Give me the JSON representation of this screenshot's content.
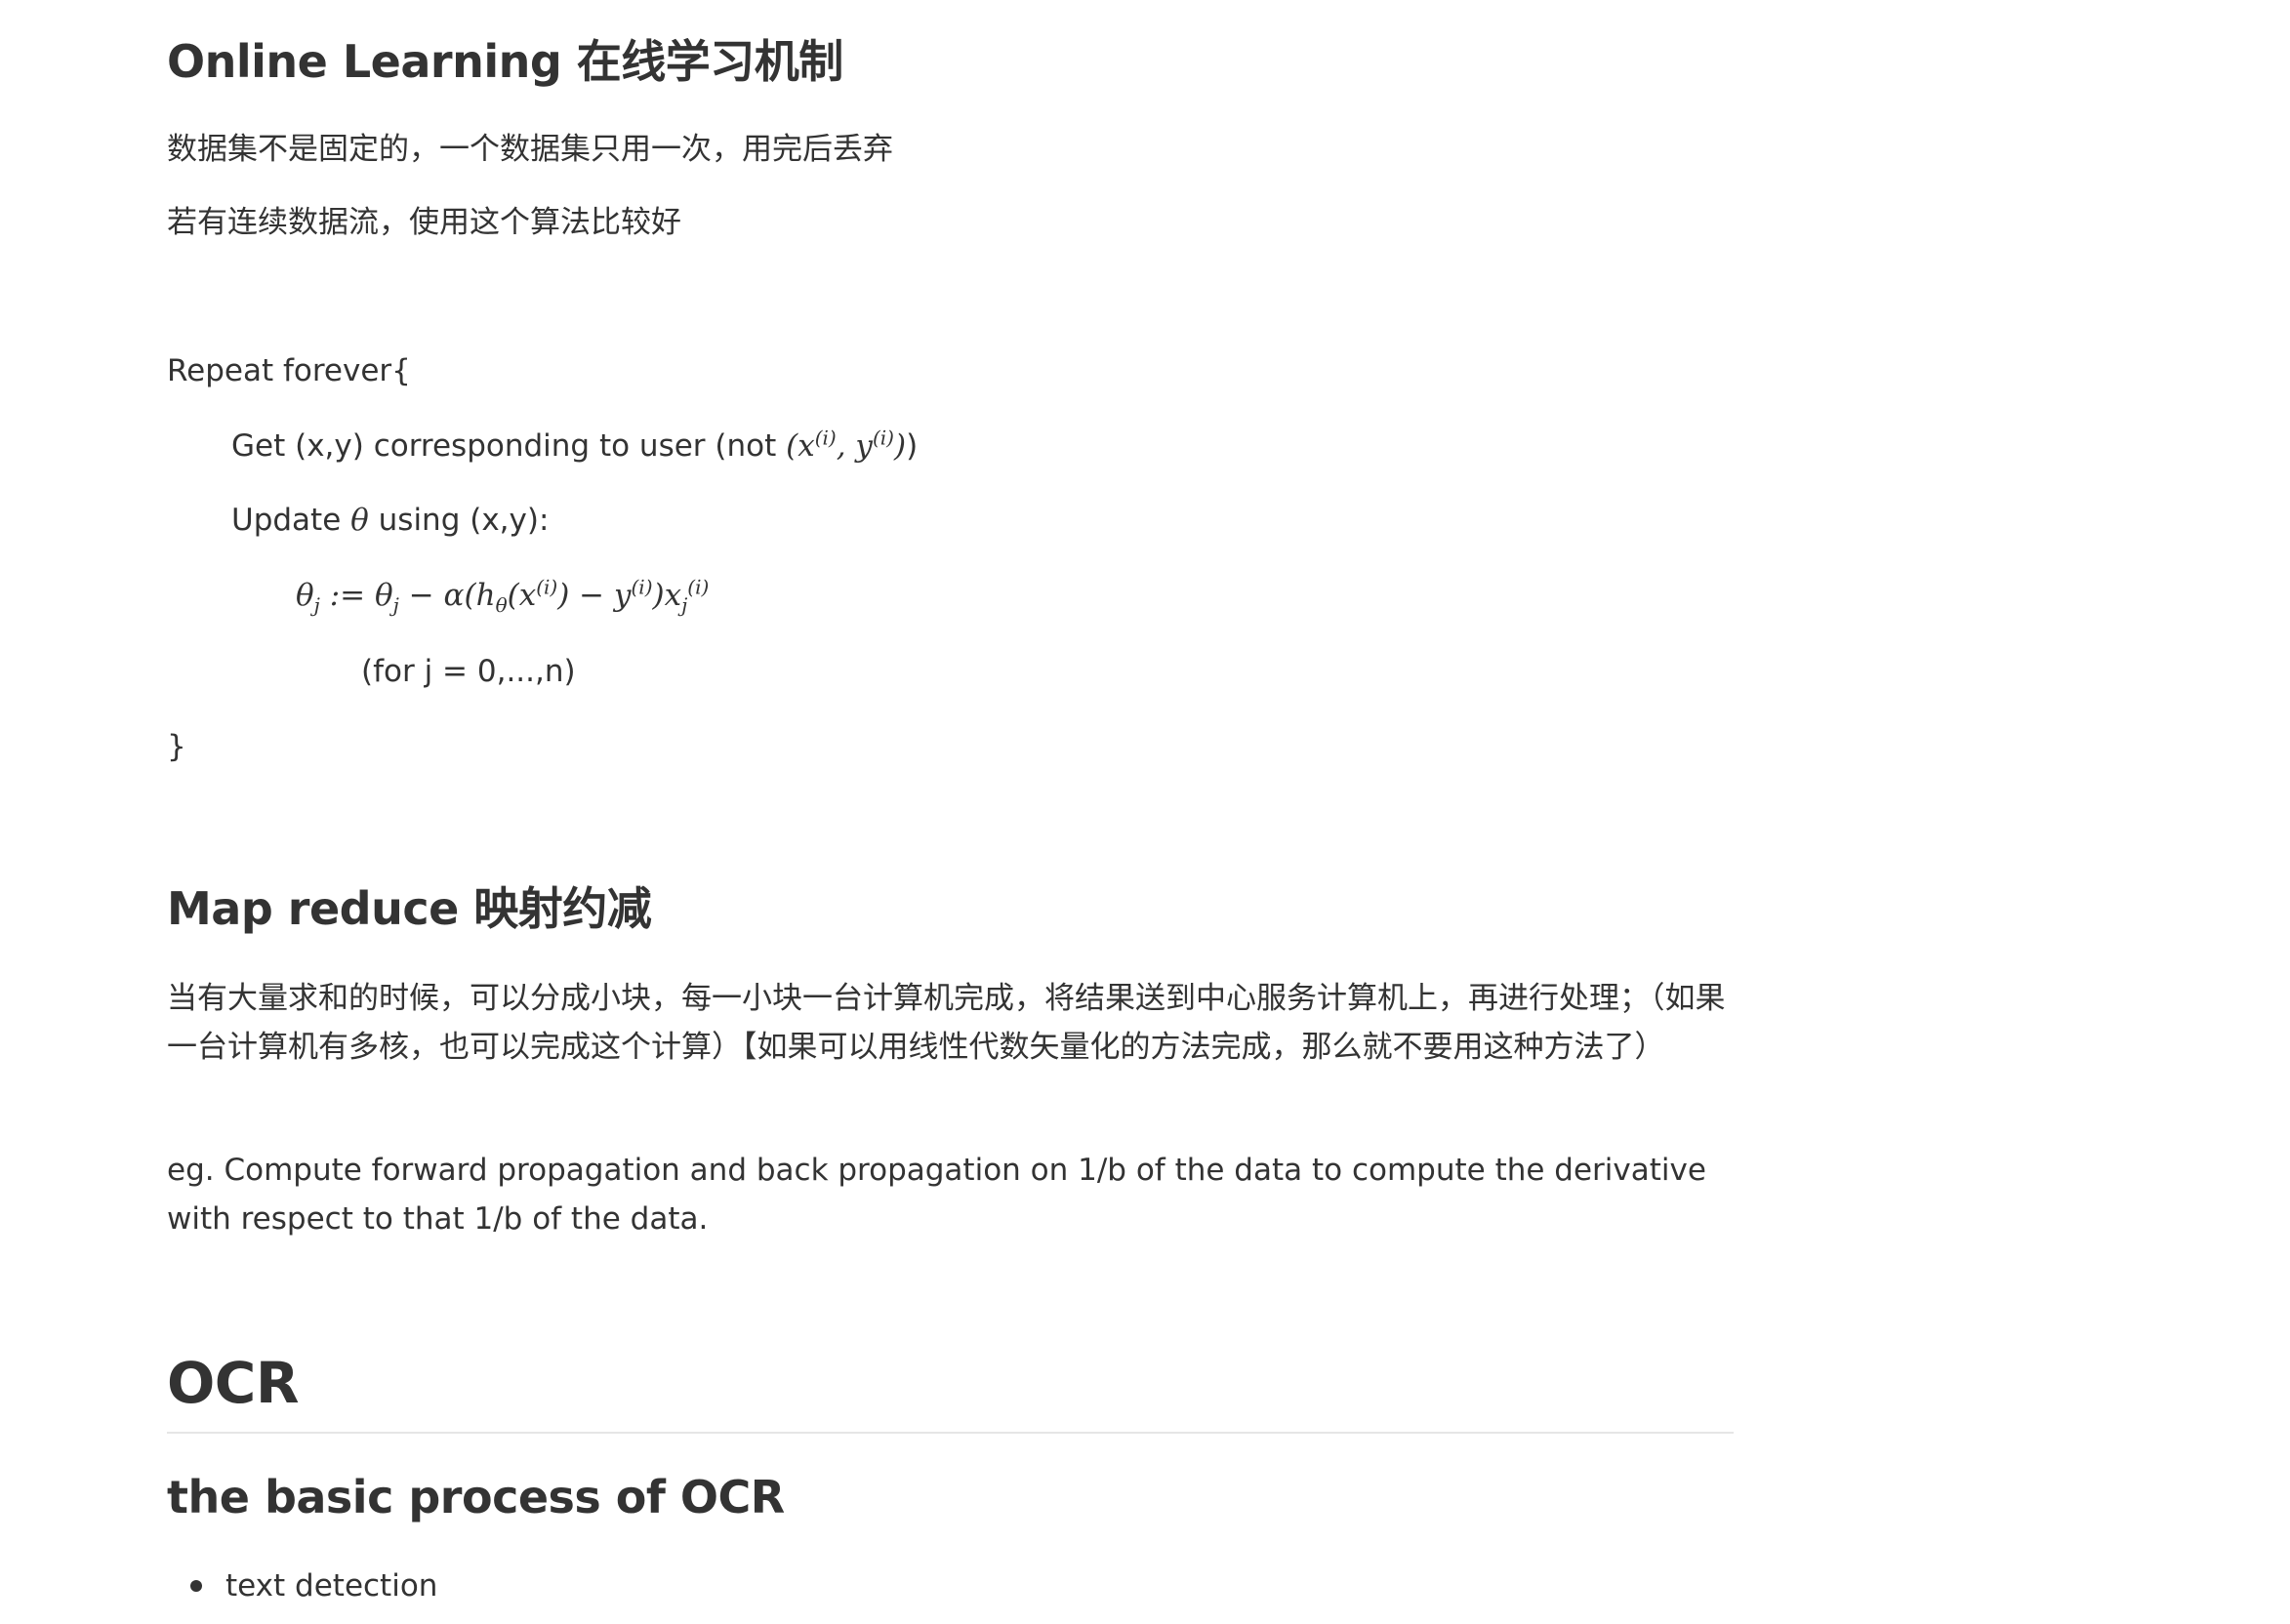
{
  "online_learning": {
    "heading": "Online Learning 在线学习机制",
    "desc1": "数据集不是固定的，一个数据集只用一次，用完后丢弃",
    "desc2": "若有连续数据流，使用这个算法比较好",
    "code": {
      "repeat": "Repeat forever{",
      "get_prefix": "Get (x,y) corresponding to user (not ",
      "get_suffix": ")",
      "update_prefix": "Update ",
      "update_suffix": " using (x,y):",
      "for_j": "(for j = 0,...,n)",
      "close": "}"
    }
  },
  "map_reduce": {
    "heading": "Map reduce 映射约减",
    "desc": "当有大量求和的时候，可以分成小块，每一小块一台计算机完成，将结果送到中心服务计算机上，再进行处理；（如果一台计算机有多核，也可以完成这个计算）【如果可以用线性代数矢量化的方法完成，那么就不要用这种方法了）",
    "example": "eg. Compute forward propagation and back propagation on 1/b of the data to compute the derivative with respect to that 1/b of the data."
  },
  "ocr": {
    "heading": "OCR",
    "subheading": "the basic process of OCR",
    "items": [
      "text detection"
    ]
  }
}
